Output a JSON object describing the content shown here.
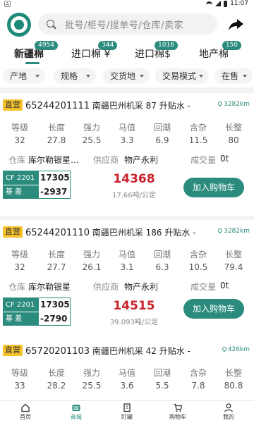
{
  "status": {
    "app_tag": "A",
    "time": "11:07"
  },
  "search": {
    "placeholder": "批号/柜号/提单号/仓库/卖家"
  },
  "tabs": [
    {
      "label": "新疆棉",
      "badge": "4954"
    },
    {
      "label": "进口棉 ¥",
      "badge": "344"
    },
    {
      "label": "进口棉$",
      "badge": "1016"
    },
    {
      "label": "地产棉",
      "badge": "150"
    }
  ],
  "filters": [
    "产地",
    "规格",
    "交货地",
    "交易模式",
    "在售"
  ],
  "metric_labels": [
    "等级",
    "长度",
    "强力",
    "马值",
    "回潮",
    "含杂",
    "长整"
  ],
  "info_labels": {
    "warehouse": "仓库",
    "supplier": "供应商",
    "volume": "成交量"
  },
  "cf_labels": {
    "contract": "CF 2201",
    "basis": "基    差"
  },
  "add_cart_label": "加入购物车",
  "listings": [
    {
      "tag": "直营",
      "lot": "65244201111",
      "desc": "南疆巴州机采 87 升贴水 -",
      "distance": "3282km",
      "metrics": [
        "32",
        "27.8",
        "25.5",
        "3.3",
        "6.9",
        "11.5",
        "80"
      ],
      "warehouse": "库尔勒银星…",
      "supplier": "物产永利",
      "volume": "0t",
      "cf_value": "17305",
      "basis_value": "-2937",
      "price": "14368",
      "per_ton": "17.66吨/公定"
    },
    {
      "tag": "直营",
      "lot": "65244201110",
      "desc": "南疆巴州机采 186 升贴水 -",
      "distance": "3282km",
      "metrics": [
        "32",
        "27.7",
        "26.1",
        "3.1",
        "6.3",
        "10.5",
        "79.4"
      ],
      "warehouse": "库尔勒银星",
      "supplier": "物产永利",
      "volume": "0t",
      "cf_value": "17305",
      "basis_value": "-2790",
      "price": "14515",
      "per_ton": "39.093吨/公定"
    },
    {
      "tag": "直营",
      "lot": "65720201103",
      "desc": "南疆巴州机采 42 升贴水 -",
      "distance": "426km",
      "metrics": [
        "33",
        "28.2",
        "25.5",
        "3.6",
        "5.5",
        "7.8",
        "80.8"
      ],
      "warehouse": "",
      "supplier": "",
      "volume": "",
      "cf_value": "",
      "basis_value": "",
      "price": "",
      "per_ton": ""
    }
  ],
  "bottom_nav": [
    {
      "label": "首页",
      "icon": "home-icon"
    },
    {
      "label": "商城",
      "icon": "mall-icon"
    },
    {
      "label": "盯罐",
      "icon": "building-icon"
    },
    {
      "label": "购物车",
      "icon": "cart-icon"
    },
    {
      "label": "我的",
      "icon": "person-icon"
    }
  ],
  "colors": {
    "brand": "#2b8c7d",
    "price": "#c8232c",
    "tag": "#f6c22b"
  }
}
